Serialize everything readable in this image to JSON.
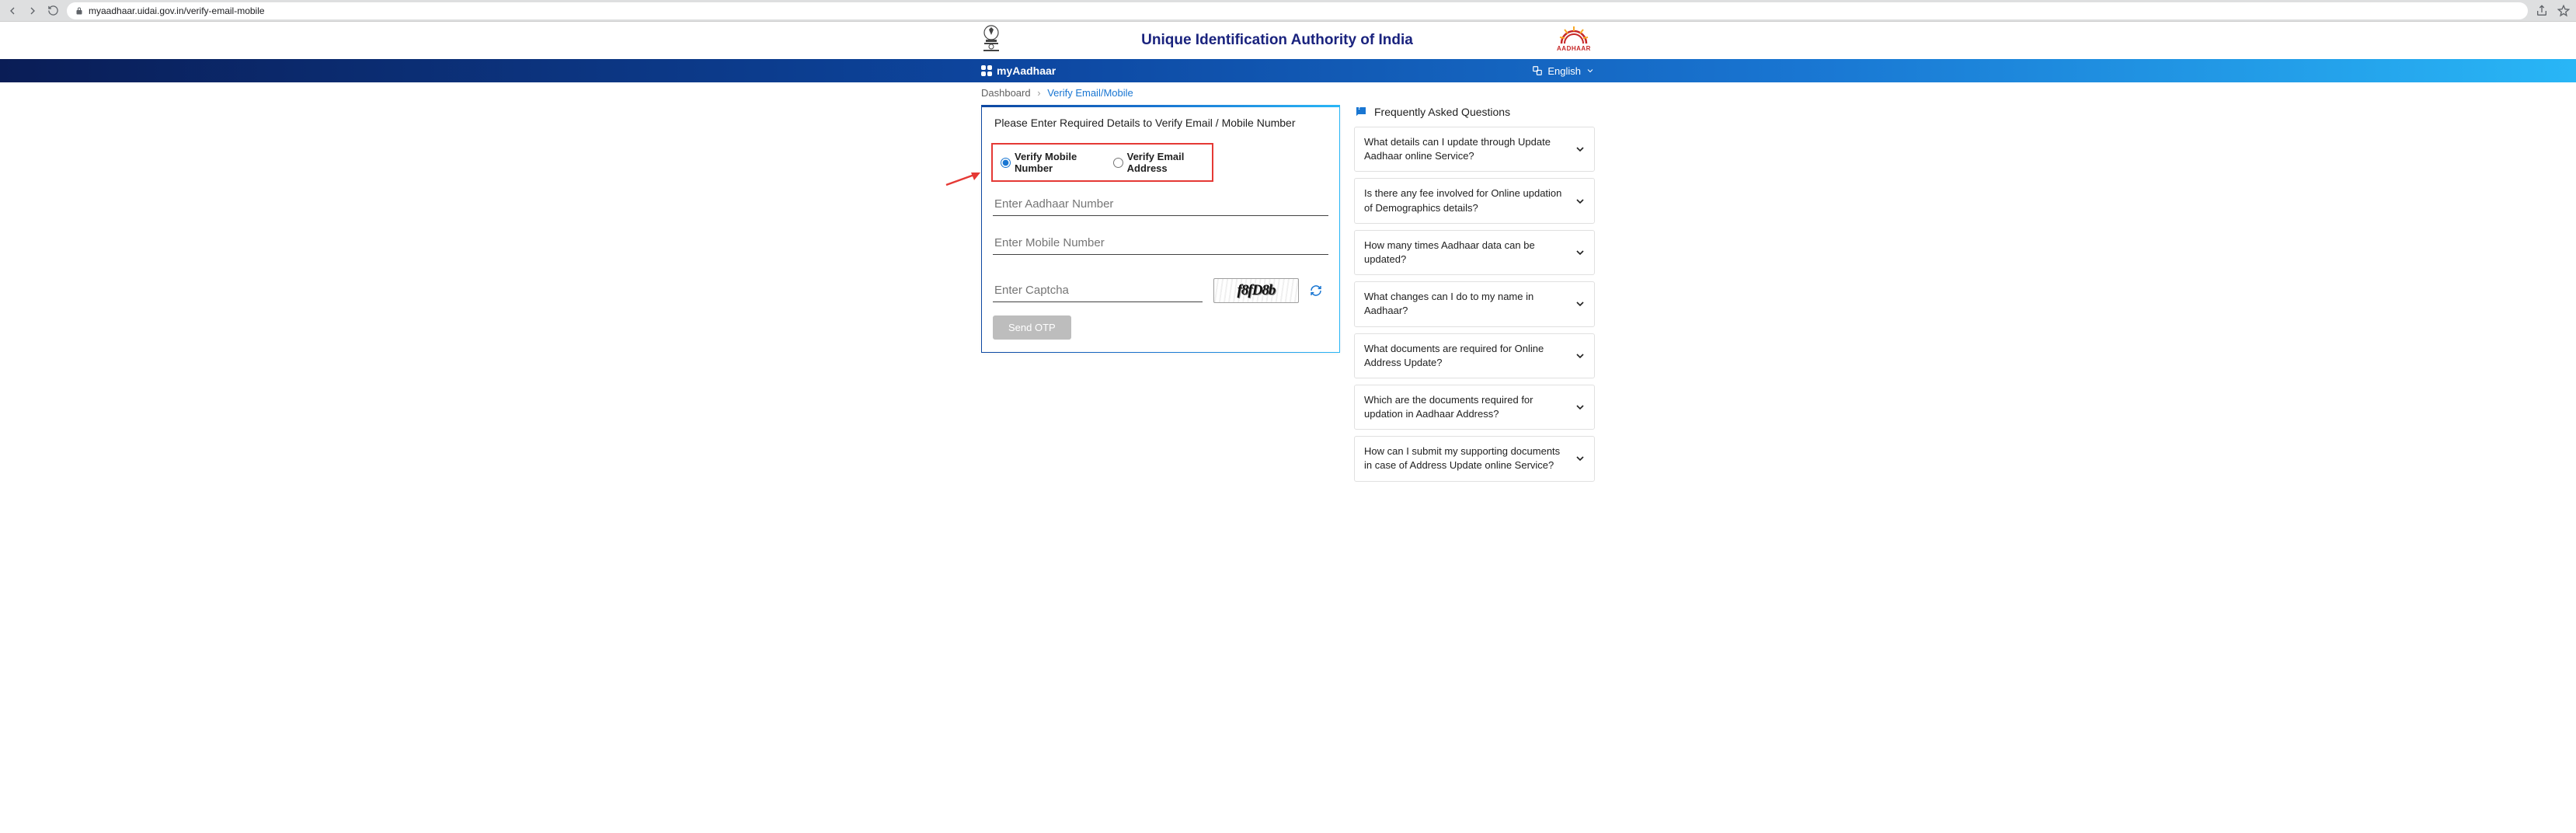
{
  "browser": {
    "url": "myaadhaar.uidai.gov.in/verify-email-mobile"
  },
  "header": {
    "title": "Unique Identification Authority of India",
    "aadhaar_logo_text": "AADHAAR"
  },
  "navbar": {
    "brand": "myAadhaar",
    "language": "English"
  },
  "breadcrumb": {
    "root": "Dashboard",
    "current": "Verify Email/Mobile"
  },
  "form": {
    "lead": "Please Enter Required Details to Verify Email / Mobile Number",
    "radio_mobile": "Verify Mobile Number",
    "radio_email": "Verify Email Address",
    "aadhaar_placeholder": "Enter Aadhaar Number",
    "mobile_placeholder": "Enter Mobile Number",
    "captcha_placeholder": "Enter Captcha",
    "captcha_text": "f8fD8b",
    "send_otp": "Send OTP"
  },
  "faq": {
    "title": "Frequently Asked Questions",
    "items": [
      "What details can I update through Update Aadhaar online Service?",
      "Is there any fee involved for Online updation of Demographics details?",
      "How many times Aadhaar data can be updated?",
      "What changes can I do to my name in Aadhaar?",
      "What documents are required for Online Address Update?",
      "Which are the documents required for updation in Aadhaar Address?",
      "How can I submit my supporting documents in case of Address Update online Service?"
    ]
  }
}
